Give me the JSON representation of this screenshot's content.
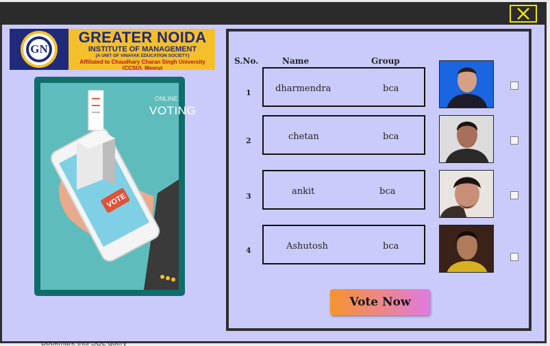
{
  "window": {
    "close_icon": "close-icon",
    "accent_close": "#f2e600",
    "background": "#cbcbfb"
  },
  "logo": {
    "title": "GREATER NOIDA",
    "subtitle": "INSTITUTE OF MANAGEMENT",
    "unit": "(A UNIT OF VINAYAK EDUCATION SOCIETY)",
    "affiliation": "Affiliated to Chaudhary Charan Singh University (CCSU), Meerut",
    "emblem_letters": "GN"
  },
  "poster": {
    "line1": "ONLINE",
    "line2": "VOTING",
    "badge": "VOTE"
  },
  "table": {
    "headers": {
      "sno": "S.No.",
      "name": "Name",
      "group": "Group"
    },
    "rows": [
      {
        "sno": "1",
        "name": "dharmendra",
        "group": "bca",
        "checked": false
      },
      {
        "sno": "2",
        "name": "chetan",
        "group": "bca",
        "checked": false
      },
      {
        "sno": "3",
        "name": "ankit",
        "group": "bca",
        "checked": false
      },
      {
        "sno": "4",
        "name": "Ashutosh",
        "group": "bca",
        "checked": false
      }
    ]
  },
  "actions": {
    "vote_label": "Vote Now"
  },
  "background_app": {
    "bottom_text": "Bookmark this SQL query"
  }
}
